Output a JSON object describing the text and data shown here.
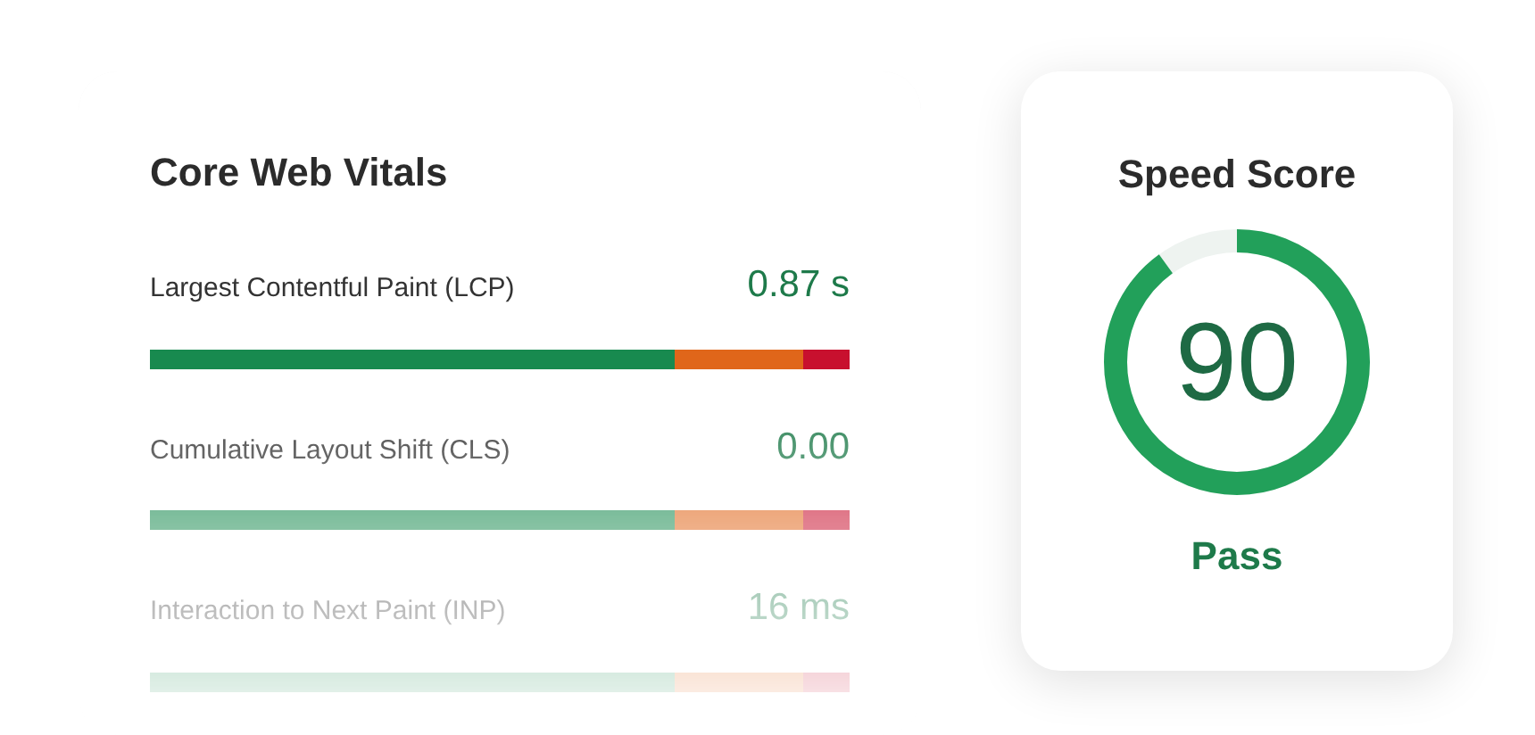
{
  "vitals": {
    "title": "Core Web Vitals",
    "metrics": [
      {
        "label": "Largest Contentful Paint (LCP)",
        "value": "0.87 s"
      },
      {
        "label": "Cumulative Layout Shift (CLS)",
        "value": "0.00"
      },
      {
        "label": "Interaction to Next Paint (INP)",
        "value": "16 ms"
      }
    ]
  },
  "speed": {
    "title": "Speed Score",
    "score": "90",
    "level": 0.9,
    "verdict": "Pass"
  }
}
